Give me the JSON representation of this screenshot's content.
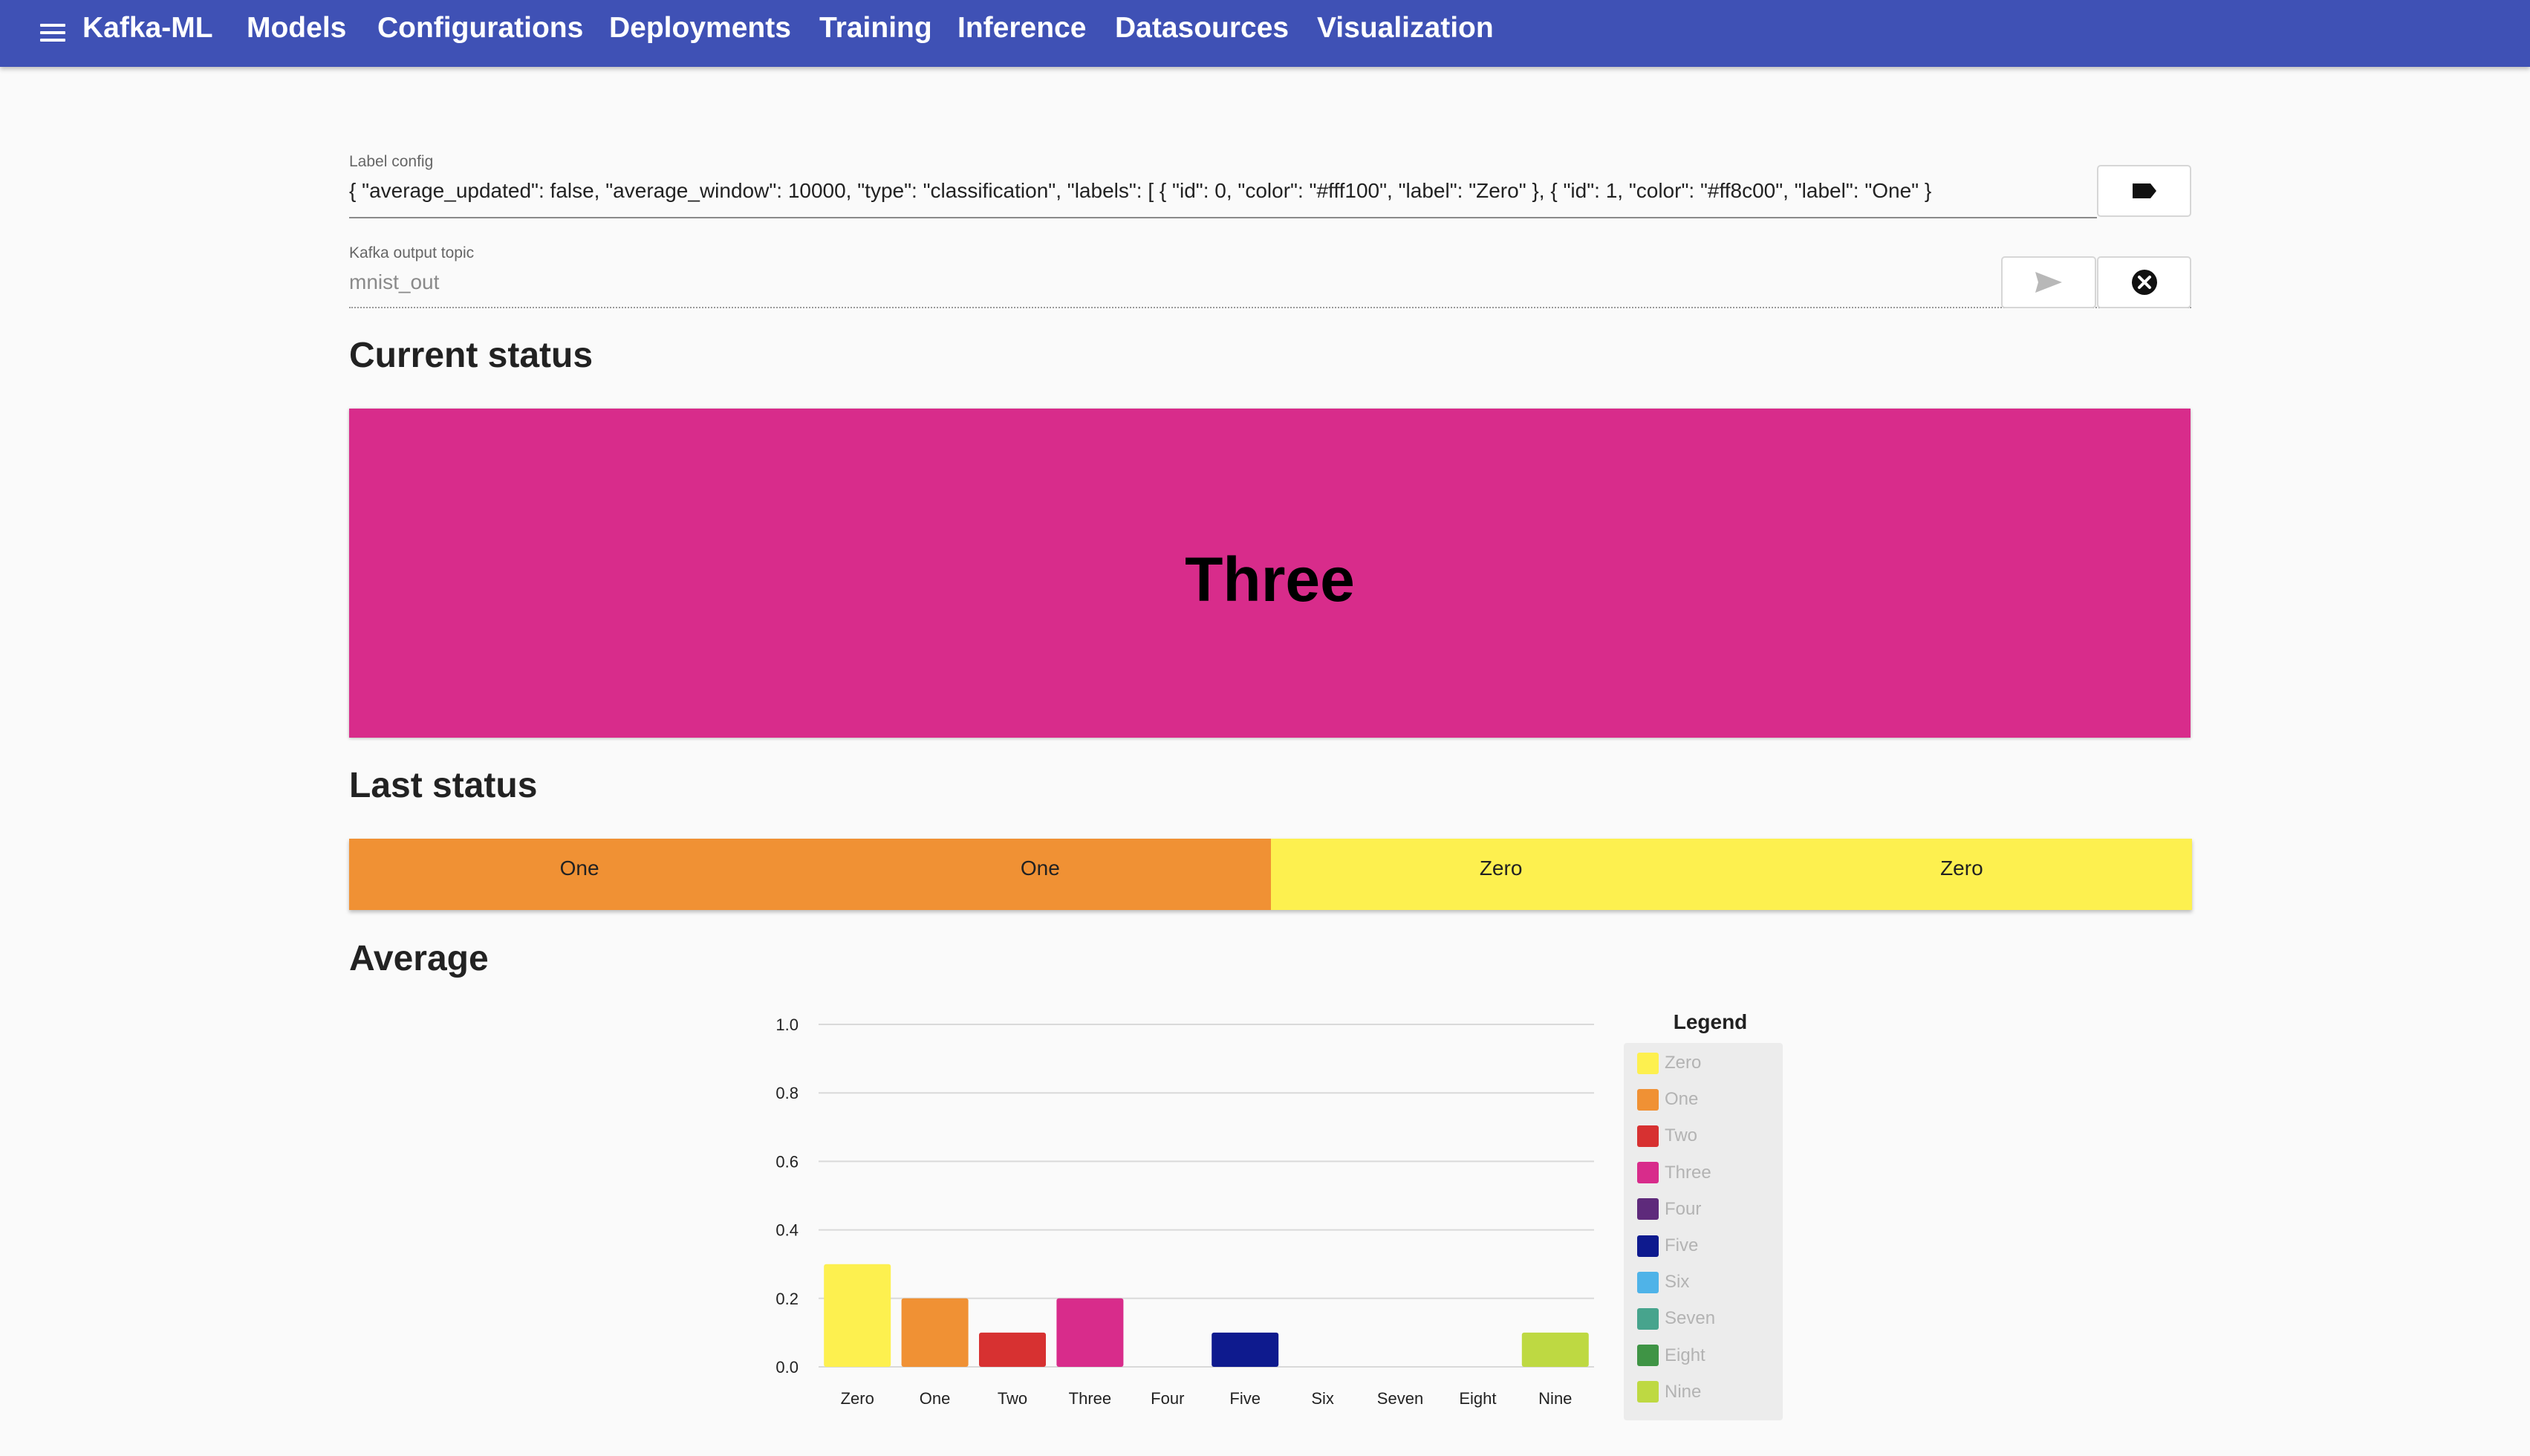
{
  "app": {
    "title": "Kafka-ML",
    "nav": [
      "Models",
      "Configurations",
      "Deployments",
      "Training",
      "Inference",
      "Datasources",
      "Visualization"
    ]
  },
  "form": {
    "label_config": {
      "label": "Label config",
      "value": "{   \"average_updated\": false,   \"average_window\": 10000,   \"type\": \"classification\",   \"labels\": [    {      \"id\": 0,      \"color\": \"#fff100\",      \"label\": \"Zero\"    },    {      \"id\": 1,      \"color\": \"#ff8c00\",      \"label\": \"One\"    }"
    },
    "kafka_topic": {
      "label": "Kafka output topic",
      "value": "mnist_out"
    }
  },
  "icons": {
    "menu": "menu-icon",
    "label": "label-icon",
    "send": "send-icon",
    "cancel": "cancel-icon"
  },
  "current_status": {
    "heading": "Current status",
    "label": "Three",
    "color": "#d82c8b"
  },
  "last_status": {
    "heading": "Last status",
    "items": [
      {
        "label": "One",
        "color": "#f09134"
      },
      {
        "label": "One",
        "color": "#f09134"
      },
      {
        "label": "Zero",
        "color": "#fdf04f"
      },
      {
        "label": "Zero",
        "color": "#fdf04f"
      }
    ]
  },
  "average": {
    "heading": "Average",
    "legend_title": "Legend"
  },
  "chart_data": {
    "type": "bar",
    "categories": [
      "Zero",
      "One",
      "Two",
      "Three",
      "Four",
      "Five",
      "Six",
      "Seven",
      "Eight",
      "Nine"
    ],
    "values": [
      0.3,
      0.2,
      0.1,
      0.2,
      0,
      0.1,
      0,
      0,
      0,
      0.1
    ],
    "colors": [
      "#fdf04f",
      "#f09134",
      "#d73131",
      "#d82c8b",
      "#5e2a7b",
      "#0e1a8e",
      "#4fb3e8",
      "#47a48d",
      "#3f9445",
      "#bed942"
    ],
    "ylim": [
      0,
      1.0
    ],
    "yticks": [
      "0.0",
      "0.2",
      "0.4",
      "0.6",
      "0.8",
      "1.0"
    ],
    "grid": true,
    "legend_position": "right"
  }
}
